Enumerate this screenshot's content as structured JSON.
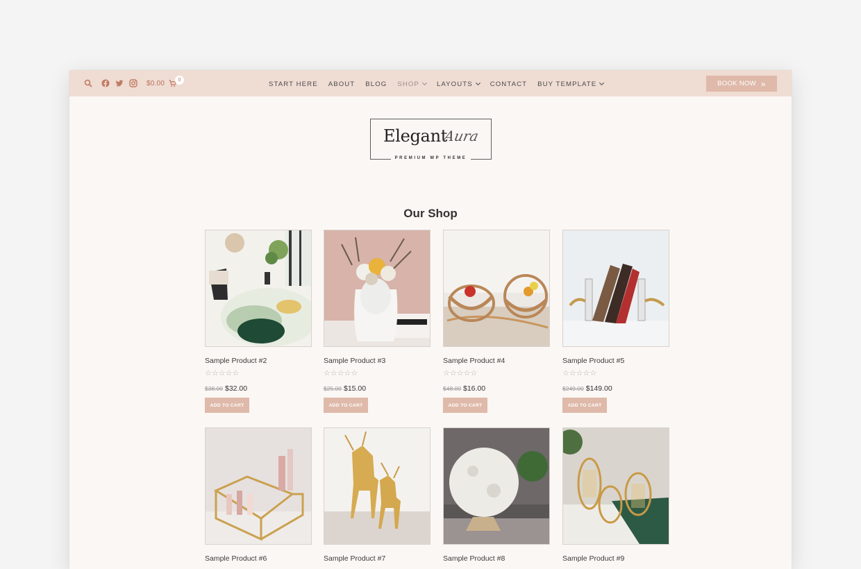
{
  "header": {
    "cart_total": "$0.00",
    "cart_count": "0",
    "icons": [
      "search-icon",
      "facebook-icon",
      "twitter-icon",
      "instagram-icon",
      "cart-icon"
    ],
    "nav": [
      {
        "label": "START HERE"
      },
      {
        "label": "ABOUT"
      },
      {
        "label": "BLOG"
      },
      {
        "label": "SHOP"
      },
      {
        "label": "LAYOUTS"
      },
      {
        "label": "CONTACT"
      },
      {
        "label": "BUY TEMPLATE"
      }
    ],
    "book_now": "BOOK NOW",
    "colors": {
      "bar": "#efdcd3",
      "accent": "#dfb9a9",
      "icon": "#c07b63"
    }
  },
  "logo": {
    "main": "Elegant",
    "script": "Aura",
    "sub": "PREMIUM WP THEME"
  },
  "shop": {
    "title": "Our Shop",
    "rating_display": "☆☆☆☆☆",
    "add_to_cart": "ADD TO CART",
    "products": [
      {
        "name": "Sample Product #2",
        "old_price": "$38.00",
        "price": "$32.00",
        "rating": 0
      },
      {
        "name": "Sample Product #3",
        "old_price": "$25.00",
        "price": "$15.00",
        "rating": 0
      },
      {
        "name": "Sample Product #4",
        "old_price": "$48.00",
        "price": "$16.00",
        "rating": 0
      },
      {
        "name": "Sample Product #5",
        "old_price": "$249.00",
        "price": "$149.00",
        "rating": 0
      },
      {
        "name": "Sample Product #6"
      },
      {
        "name": "Sample Product #7"
      },
      {
        "name": "Sample Product #8"
      },
      {
        "name": "Sample Product #9"
      }
    ]
  }
}
